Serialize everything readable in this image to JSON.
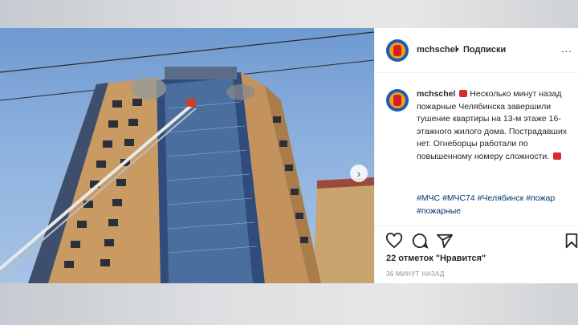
{
  "post": {
    "username": "mchschel",
    "separator": "•",
    "follow_label": "Подписки",
    "more_label": "...",
    "caption": "Несколько минут назад пожарные Челябинска завершили тушение квартиры на 13-м этаже 16-этажного жилого дома. Пострадавших нет. Огнеборцы работали по повышенному номеру сложности.",
    "hashtags": [
      "#МЧС",
      "#МЧС74",
      "#Челябинск",
      "#пожар",
      "#пожарные"
    ],
    "likes": "22 отметок \"Нравится\"",
    "time": "36 МИНУТ НАЗАД",
    "next_label": "›"
  },
  "icons": {
    "like": "heart-icon",
    "comment": "comment-icon",
    "share": "paper-plane-icon",
    "save": "bookmark-icon",
    "siren": "siren-emoji",
    "fire_engine": "fire-engine-emoji"
  },
  "colors": {
    "hashtag": "#00376b",
    "text": "#262626",
    "muted": "#8e8e8e"
  }
}
